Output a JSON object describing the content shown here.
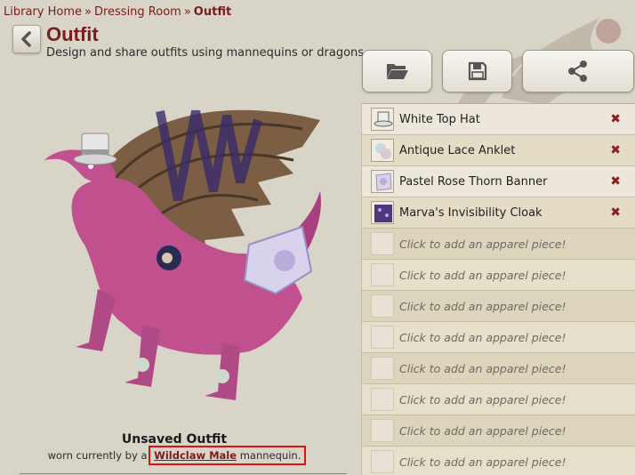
{
  "breadcrumb": {
    "home": "Library Home",
    "section": "Dressing Room",
    "current": "Outfit",
    "sep": "»"
  },
  "header": {
    "title": "Outfit",
    "subtitle": "Design and share outfits using mannequins or dragons."
  },
  "toolbar": {
    "open_icon": "folder-open-icon",
    "save_icon": "floppy-disk-icon",
    "share_icon": "share-icon"
  },
  "apparel": {
    "items": [
      {
        "name": "White Top Hat",
        "remove": "✖"
      },
      {
        "name": "Antique Lace Anklet",
        "remove": "✖"
      },
      {
        "name": "Pastel Rose Thorn Banner",
        "remove": "✖"
      },
      {
        "name": "Marva's Invisibility Cloak",
        "remove": "✖"
      }
    ],
    "placeholder": "Click to add an apparel piece!"
  },
  "outfit": {
    "title": "Unsaved Outfit",
    "worn_prefix": "worn currently by a",
    "mannequin": "Wildclaw Male",
    "worn_suffix": "mannequin."
  },
  "colors": {
    "accent": "#7a1c1c",
    "background": "#d9d4c8",
    "highlight": "#e01010"
  }
}
